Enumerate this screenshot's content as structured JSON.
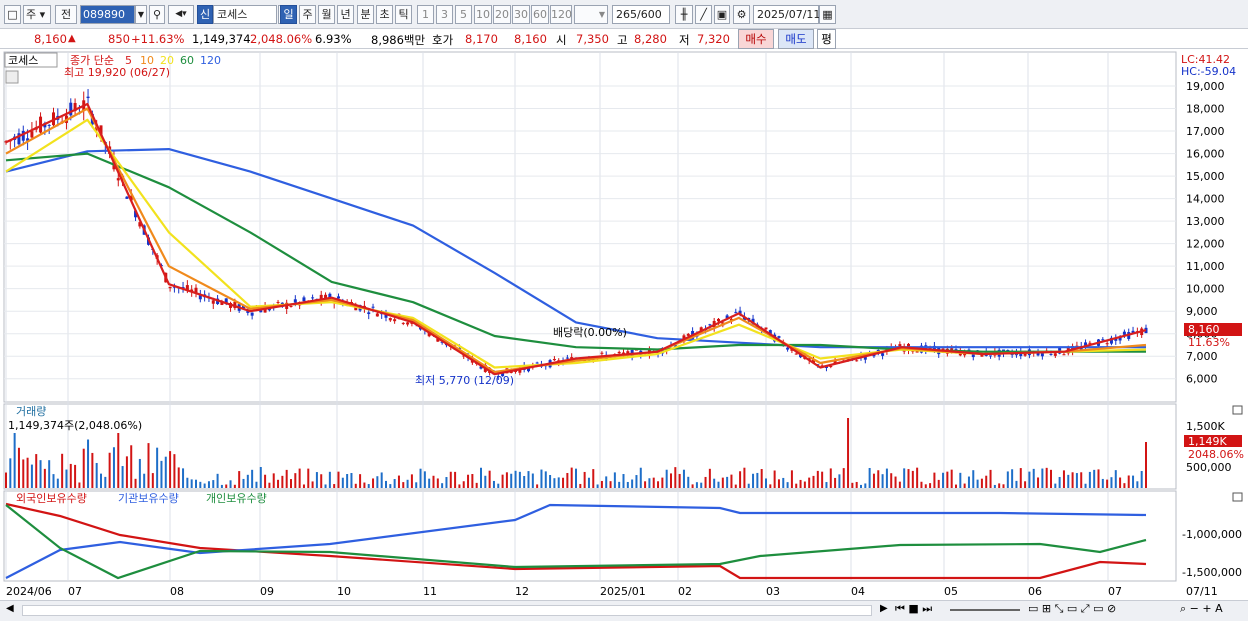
{
  "toolbar": {
    "market_type": "주",
    "period_select": "전",
    "stock_code": "089890",
    "new_badge": "신",
    "stock_name": "코세스",
    "periods": [
      "일",
      "주",
      "월",
      "년",
      "분",
      "초",
      "틱"
    ],
    "active_period": "일",
    "minute_units": [
      "1",
      "3",
      "5",
      "10",
      "20",
      "30",
      "60",
      "120"
    ],
    "count_display": "265",
    "count_max": "/600",
    "date": "2025/07/11"
  },
  "quote": {
    "price": "8,160",
    "change": "850",
    "change_pct": "+11.63%",
    "volume": "1,149,374",
    "volume_ratio": "2,048.06%",
    "turnover": "6.93%",
    "amount": "8,986백만",
    "hoga_label": "호가",
    "ask": "8,170",
    "bid": "8,160",
    "open_label": "시",
    "open": "7,350",
    "high_label": "고",
    "high": "8,280",
    "low_label": "저",
    "low": "7,320",
    "buy_label": "매수",
    "sell_label": "매도",
    "eval_label": "평"
  },
  "price_pane": {
    "stock_label": "코세스",
    "ma_label": "종가 단순",
    "ma_periods": [
      "5",
      "10",
      "20",
      "60",
      "120"
    ],
    "ma_colors": [
      "#d81e1e",
      "#f08a1c",
      "#f2e21e",
      "#1e8e3e",
      "#2f5fe0"
    ],
    "high_marker": "최고 19,920 (06/27)",
    "low_marker": "최저 5,770 (12/09)",
    "dividend_marker": "배당락(0.00%)",
    "lc": "LC:41.42",
    "hc": "HC:-59.04",
    "y_ticks": [
      "19,000",
      "18,000",
      "17,000",
      "16,000",
      "15,000",
      "14,000",
      "13,000",
      "12,000",
      "11,000",
      "10,000",
      "9,000",
      "8,000",
      "7,000",
      "6,000"
    ],
    "current_price_tag": "8,160",
    "current_pct_tag": "11.63%"
  },
  "volume_pane": {
    "title": "거래량",
    "value_label": "1,149,374주(2,048.06%)",
    "y_ticks": [
      "1,500K",
      "1,000K",
      "500,000"
    ],
    "current_tag": "1,149K",
    "current_pct_tag": "2048.06%"
  },
  "holding_pane": {
    "legend": [
      "외국인보유수량",
      "기관보유수량",
      "개인보유수량"
    ],
    "legend_colors": [
      "#d21414",
      "#2f5fe0",
      "#1e8e3e"
    ],
    "y_ticks": [
      "-1,000,000",
      "-1,500,000"
    ]
  },
  "x_axis": {
    "labels": [
      "2024/06",
      "07",
      "08",
      "09",
      "10",
      "11",
      "12",
      "2025/01",
      "02",
      "03",
      "04",
      "05",
      "06",
      "07"
    ],
    "last_date": "07/11"
  },
  "chart_data": {
    "type": "line",
    "y_range": [
      5500,
      19800
    ],
    "x": [
      "2024/06",
      "07",
      "08",
      "09",
      "10",
      "11",
      "12",
      "2025/01",
      "02",
      "03",
      "04",
      "05",
      "06",
      "07",
      "07/11"
    ],
    "series": [
      {
        "name": "5",
        "values": [
          16500,
          18200,
          10200,
          9000,
          9600,
          8500,
          6200,
          6900,
          7200,
          8900,
          6500,
          7400,
          7100,
          7200,
          8160
        ]
      },
      {
        "name": "10",
        "values": [
          16000,
          18000,
          11000,
          9100,
          9500,
          8600,
          6300,
          6800,
          7200,
          8700,
          6700,
          7350,
          7100,
          7200,
          7500
        ]
      },
      {
        "name": "20",
        "values": [
          15200,
          17500,
          12500,
          9200,
          9400,
          8700,
          6500,
          6700,
          7100,
          8400,
          6900,
          7300,
          7100,
          7200,
          7300
        ]
      },
      {
        "name": "60",
        "values": [
          15700,
          16000,
          14500,
          12500,
          10300,
          9400,
          7900,
          7400,
          7300,
          7500,
          7500,
          7300,
          7200,
          7200,
          7200
        ]
      },
      {
        "name": "120",
        "values": [
          15200,
          16100,
          16200,
          15200,
          14000,
          12800,
          10700,
          8500,
          7800,
          7600,
          7400,
          7400,
          7400,
          7400,
          7400
        ]
      }
    ]
  }
}
